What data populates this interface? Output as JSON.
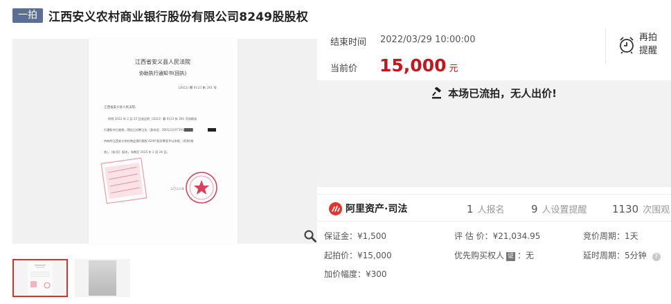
{
  "header": {
    "badge": "一拍",
    "title": "江西安义农村商业银行股份有限公司8249股股权"
  },
  "document": {
    "court": "江西省安义县人民法院",
    "doc_title": "协助执行通知书(回执)",
    "case_no": "(2022) 赣 0123 执 261 号",
    "addressee": "江西省安义县人民法院:",
    "body_lines": [
      "你院 2022 年 2 月 23 日送达的（2022）赣 0123 执 261 号协助执",
      "行通知书已收悉，我社已对熊江水（身份证：360123197301████",
      "持有的江西安义农村商业银行股权 8249 股及孳息予以冻结、(扣划/拍",
      "卖)，（年/月）起冻，冻期至 2025 年 2 月 24 日。"
    ],
    "date": "二〇二二年"
  },
  "auction": {
    "end_label": "结束时间",
    "end_value": "2022/03/29 10:00:00",
    "price_label": "当前价",
    "price_value": "15,000",
    "price_unit": "元",
    "reminder_label": "再拍提醒",
    "status_message": "本场已流拍，无人出价!"
  },
  "stats": {
    "brand": "阿里资产·司法",
    "signups_num": "1",
    "signups_label": "人报名",
    "reminders_num": "9",
    "reminders_label": "人设置提醒",
    "views_num": "1130",
    "views_label": "次围观"
  },
  "details": {
    "deposit": "保证金：¥1,500",
    "start_price": "起拍价：¥15,000",
    "increment": "加价幅度：¥300",
    "appraisal": "评 估 价：¥21,034.95",
    "priority_prefix": "优先购买权人",
    "priority_badge": "证",
    "priority_value": "：无",
    "bid_period": "竞价周期：1天",
    "extension": "延时周期：5分钟"
  },
  "colors": {
    "badge_bg": "#5b6f95",
    "price_red": "#c4161c",
    "thumb_active": "#d9302a",
    "brand_red": "#e8312a"
  }
}
